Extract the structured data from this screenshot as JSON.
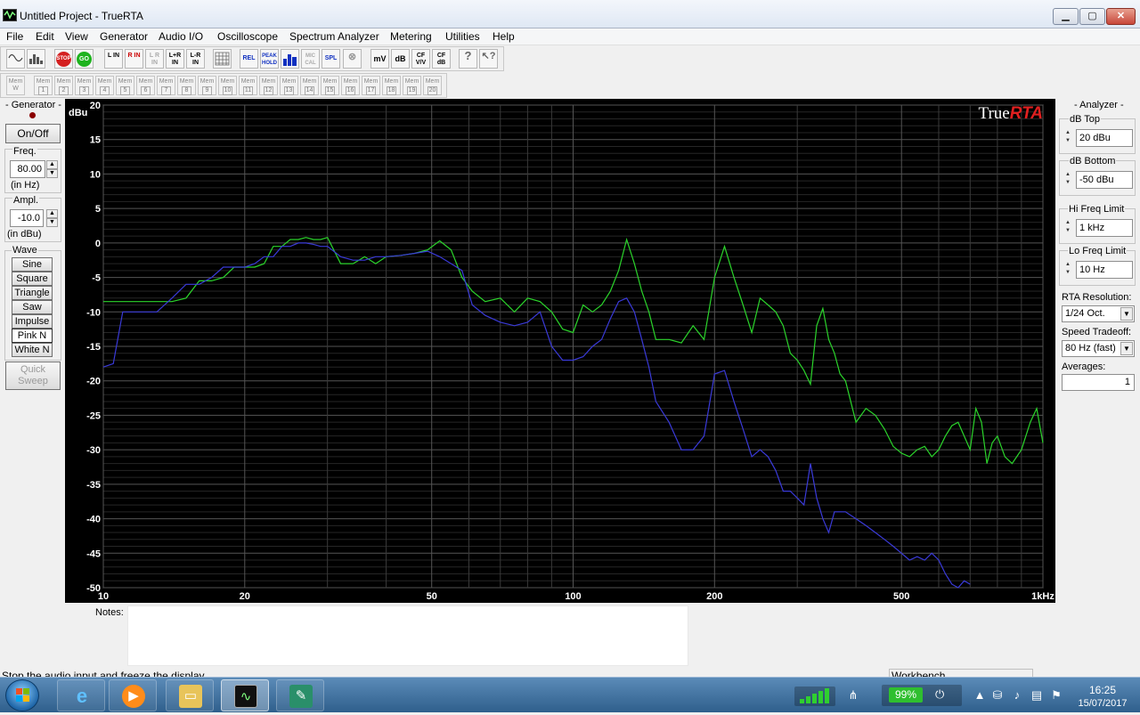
{
  "window": {
    "title": "Untitled Project - TrueRTA",
    "minimize": "▁",
    "maximize": "▢",
    "close": "✕"
  },
  "menu": [
    "File",
    "Edit",
    "View",
    "Generator",
    "Audio I/O",
    "Oscilloscope",
    "Spectrum Analyzer",
    "Metering",
    "Utilities",
    "Help"
  ],
  "toolbar": {
    "stop": "STOP",
    "go": "GO",
    "l_in": "L IN",
    "r_in": "R IN",
    "lr_in": "L R IN",
    "lpr_in": "L+R IN",
    "lmr_in": "L-R IN",
    "rel": "REL",
    "peak_hold": "PEAK HOLD",
    "mic_cal": "MIC CAL",
    "spl": "SPL",
    "mv": "mV",
    "db": "dB",
    "cf_vv": "CF V/V",
    "cf_db": "CF dB",
    "help": "?"
  },
  "memory_bar": {
    "prefix": "Mem",
    "first": "W",
    "slots": [
      "1",
      "2",
      "3",
      "4",
      "5",
      "6",
      "7",
      "8",
      "9",
      "10",
      "11",
      "12",
      "13",
      "14",
      "15",
      "16",
      "17",
      "18",
      "19",
      "20"
    ]
  },
  "generator": {
    "title": "- Generator -",
    "on_off": "On/Off",
    "freq_label": "Freq.",
    "freq_value": "80.00",
    "freq_unit": "(in Hz)",
    "ampl_label": "Ampl.",
    "ampl_value": "-10.0",
    "ampl_unit": "(in dBu)",
    "wave_label": "Wave",
    "waves": [
      "Sine",
      "Square",
      "Triangle",
      "Saw",
      "Impulse",
      "Pink N",
      "White N"
    ],
    "selected_wave": "Pink N",
    "quick_sweep": "Quick Sweep"
  },
  "analyzer": {
    "title": "- Analyzer -",
    "db_top_label": "dB Top",
    "db_top": "20 dBu",
    "db_bottom_label": "dB Bottom",
    "db_bottom": "-50 dBu",
    "hi_freq_label": "Hi Freq Limit",
    "hi_freq": "1 kHz",
    "lo_freq_label": "Lo Freq Limit",
    "lo_freq": "10 Hz",
    "rta_res_label": "RTA Resolution:",
    "rta_res": "1/24 Oct.",
    "speed_label": "Speed Tradeoff:",
    "speed": "80 Hz (fast)",
    "averages_label": "Averages:",
    "averages": "1"
  },
  "logo": {
    "true": "True",
    "rta": "RTA"
  },
  "notes": {
    "label": "Notes:",
    "value": ""
  },
  "status": {
    "text": "Stop the audio input and freeze the display",
    "panel": "Workbench"
  },
  "taskbar": {
    "battery": "99%",
    "time": "16:25",
    "date": "15/07/2017"
  },
  "colors": {
    "green_trace": "#2bd42b",
    "blue_trace": "#3a3ad8",
    "plot_bg": "#000000",
    "grid_major": "#555555",
    "grid_minor": "#262626"
  },
  "chart_data": {
    "type": "line",
    "title": "",
    "ylabel": "dBu",
    "xlabel": "",
    "x_scale": "log",
    "xlim": [
      10,
      1000
    ],
    "ylim": [
      -50,
      20
    ],
    "x_tick_labels": [
      [
        "10",
        10
      ],
      [
        "20",
        20
      ],
      [
        "50",
        50
      ],
      [
        "100",
        100
      ],
      [
        "200",
        200
      ],
      [
        "500",
        500
      ],
      [
        "1kHz",
        1000
      ]
    ],
    "y_ticks": [
      20,
      15,
      10,
      5,
      0,
      -5,
      -10,
      -15,
      -20,
      -25,
      -30,
      -35,
      -40,
      -45,
      -50
    ],
    "grid": true,
    "legend": "none",
    "series": [
      {
        "color": "green",
        "x": [
          10,
          11,
          12,
          13,
          14,
          15,
          16,
          17,
          18,
          19,
          20,
          21,
          22,
          23,
          24,
          25,
          26,
          27,
          28,
          29,
          30,
          32,
          34,
          36,
          38,
          40,
          43,
          46,
          49,
          52,
          55,
          58,
          61,
          65,
          70,
          75,
          80,
          85,
          90,
          95,
          100,
          105,
          110,
          115,
          120,
          125,
          130,
          135,
          140,
          145,
          150,
          160,
          170,
          180,
          190,
          200,
          210,
          220,
          230,
          240,
          250,
          260,
          270,
          280,
          290,
          300,
          310,
          320,
          330,
          340,
          350,
          360,
          370,
          380,
          400,
          420,
          440,
          460,
          480,
          500,
          520,
          540,
          560,
          580,
          600,
          620,
          640,
          660,
          680,
          700,
          720,
          740,
          760,
          780,
          800,
          830,
          860,
          900,
          940,
          970,
          1000
        ],
        "y": [
          -8.5,
          -8.5,
          -8.5,
          -8.5,
          -8.5,
          -8,
          -5.5,
          -5.5,
          -5,
          -3.5,
          -3.5,
          -3.5,
          -3,
          -0.5,
          -0.5,
          0.5,
          0.5,
          0.8,
          0.5,
          0.5,
          0.8,
          -3,
          -3,
          -2,
          -3,
          -2,
          -1.8,
          -1.5,
          -1,
          0.3,
          -1,
          -5,
          -7,
          -8.5,
          -8,
          -10,
          -8,
          -8.5,
          -10,
          -12.5,
          -13,
          -9,
          -10,
          -9,
          -7,
          -4,
          0.5,
          -3,
          -7,
          -10,
          -14,
          -14,
          -14.5,
          -12,
          -14,
          -5,
          -0.5,
          -5,
          -9,
          -13,
          -8,
          -9,
          -10,
          -12,
          -16,
          -17,
          -18.5,
          -20.5,
          -12,
          -9.5,
          -14,
          -16,
          -19,
          -20,
          -26,
          -24,
          -25,
          -27,
          -29.5,
          -30.5,
          -31,
          -30,
          -29.5,
          -31,
          -30,
          -28,
          -26.5,
          -26,
          -28,
          -30,
          -24,
          -26,
          -32,
          -29,
          -28,
          -31,
          -32,
          -30,
          -26,
          -24,
          -29
        ]
      },
      {
        "color": "blue",
        "x": [
          10,
          10.5,
          11,
          12,
          13,
          14,
          15,
          16,
          17,
          18,
          19,
          20,
          21,
          22,
          23,
          24,
          25,
          26,
          27,
          28,
          29,
          30,
          32,
          34,
          36,
          38,
          40,
          43,
          46,
          49,
          52,
          55,
          58,
          61,
          65,
          70,
          75,
          80,
          85,
          90,
          95,
          100,
          105,
          110,
          115,
          120,
          125,
          130,
          135,
          140,
          145,
          150,
          160,
          170,
          180,
          190,
          200,
          210,
          220,
          230,
          240,
          250,
          260,
          270,
          280,
          290,
          300,
          310,
          320,
          330,
          340,
          350,
          360,
          370,
          380,
          400,
          420,
          440,
          460,
          480,
          500,
          520,
          540,
          560,
          580,
          600,
          620,
          640,
          660,
          680,
          700
        ],
        "y": [
          -18,
          -17.5,
          -10,
          -10,
          -10,
          -8,
          -6,
          -6,
          -5,
          -3.5,
          -3.5,
          -3.5,
          -3,
          -2,
          -2,
          -0.5,
          -0.5,
          0,
          0,
          -0.2,
          -0.5,
          -0.5,
          -2,
          -2.5,
          -2.5,
          -2,
          -2,
          -1.8,
          -1.5,
          -1.2,
          -2,
          -3,
          -4,
          -9,
          -10.5,
          -11.5,
          -12,
          -11.5,
          -10,
          -15,
          -17,
          -17,
          -16.5,
          -15,
          -14,
          -11,
          -8.5,
          -8,
          -10,
          -14,
          -18,
          -23,
          -26,
          -30,
          -30,
          -28,
          -19,
          -18.5,
          -23,
          -27,
          -31,
          -30,
          -31,
          -33,
          -36,
          -36,
          -37,
          -38,
          -32,
          -37,
          -40,
          -42,
          -39,
          -39,
          -39,
          -40,
          -41,
          -42,
          -43,
          -44,
          -45,
          -46,
          -45.5,
          -46,
          -45,
          -46,
          -48,
          -49.5,
          -50,
          -49,
          -49.5
        ]
      }
    ]
  }
}
